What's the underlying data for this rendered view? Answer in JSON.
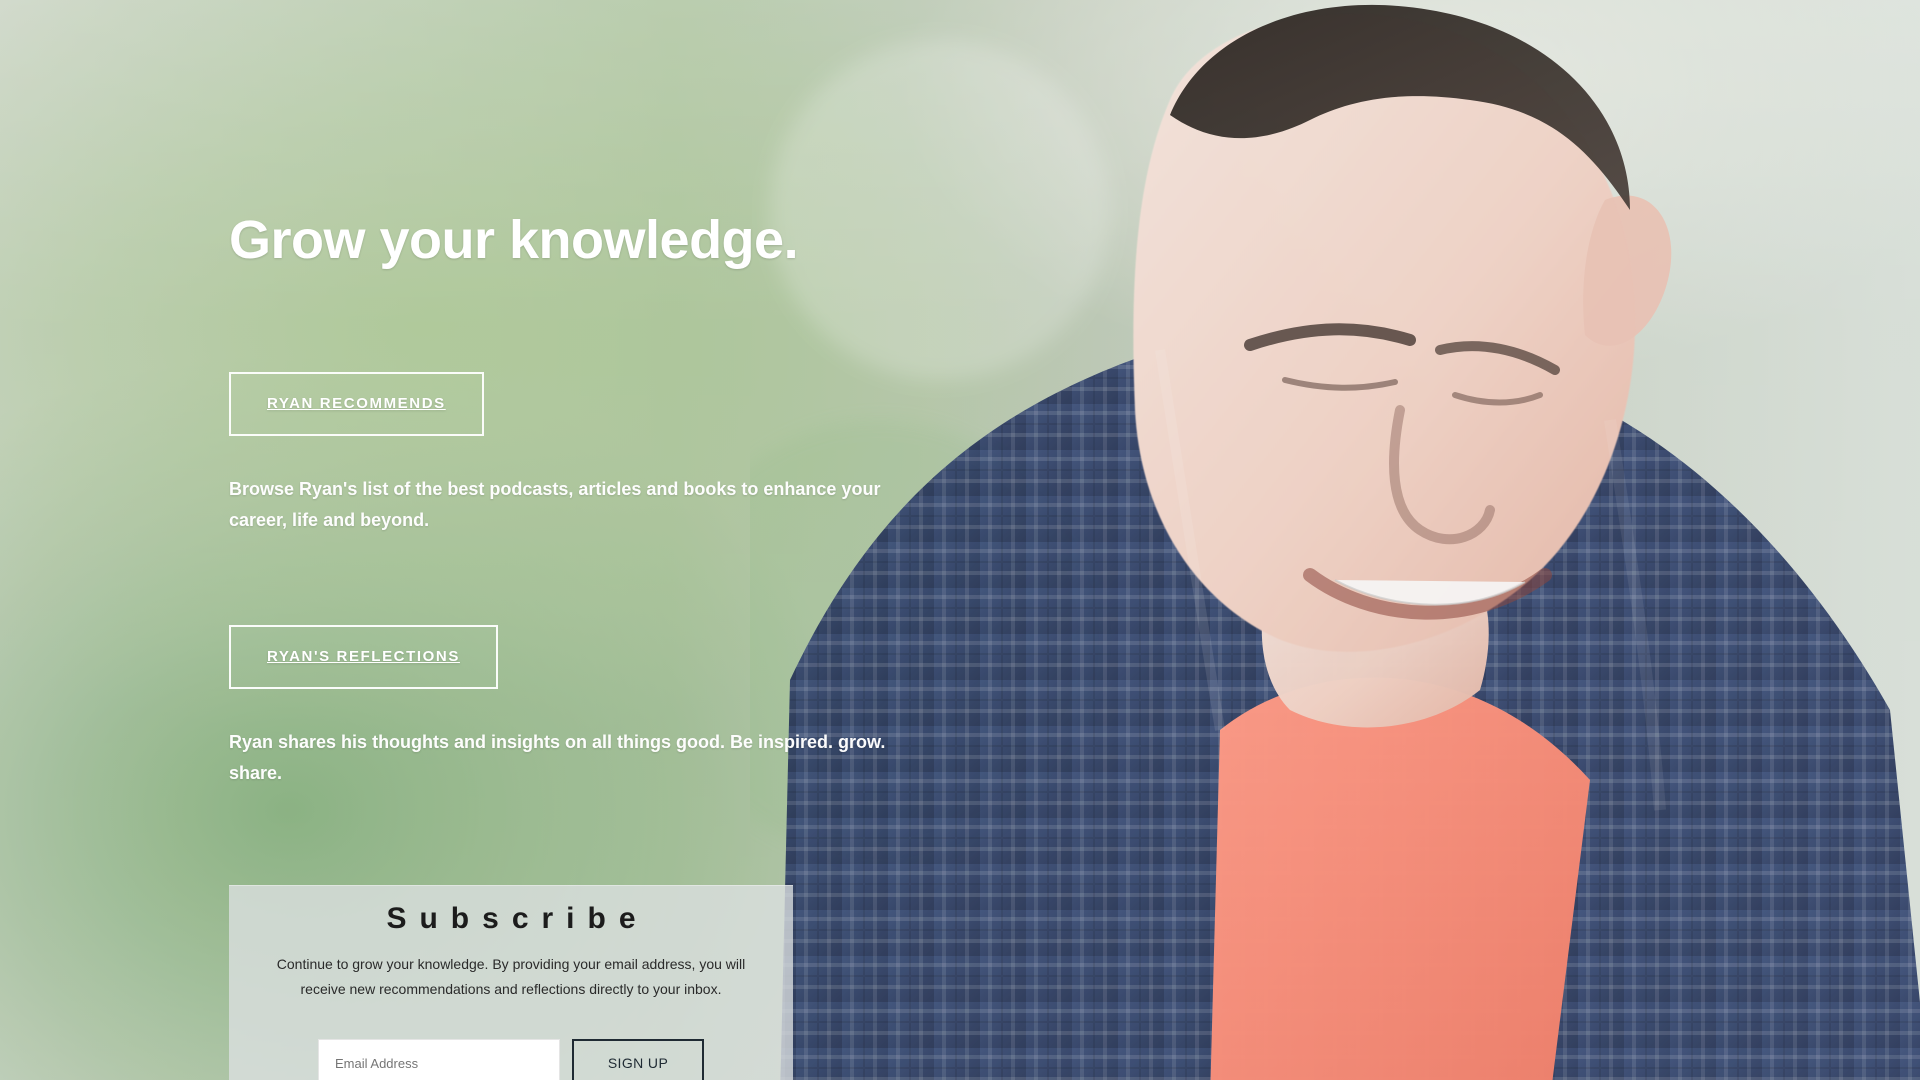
{
  "hero": {
    "headline": "Grow your knowledge.",
    "ctas": [
      {
        "label": "RYAN RECOMMENDS",
        "description": "Browse Ryan's list of the best podcasts, articles and books to enhance your career, life and beyond."
      },
      {
        "label": "RYAN'S REFLECTIONS",
        "description": "Ryan shares his thoughts and insights on all things good. Be inspired. grow. share."
      }
    ]
  },
  "subscribe": {
    "title": "Subscribe",
    "text": "Continue to grow your knowledge. By providing your email address, you will receive new recommendations and reflections directly to your inbox.",
    "email_placeholder": "Email Address",
    "button_label": "SIGN UP"
  },
  "colors": {
    "cta_border": "#ffffff",
    "panel_bg": "#dcdfe2",
    "dark_ink": "#1f2a33"
  }
}
